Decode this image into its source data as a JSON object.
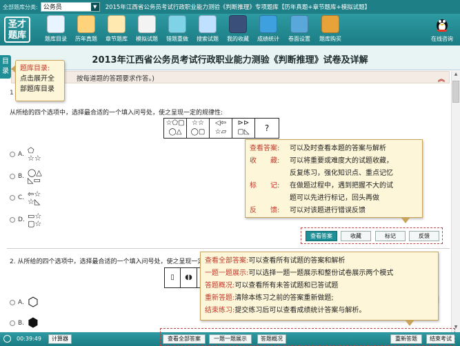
{
  "topbar": {
    "category_label": "全部题库分类:",
    "category_value": "公务员",
    "title": "2015年江西省公务员考试行政职业能力测验《判断推理》专项题库【历年真题+章节题库+模拟试题】"
  },
  "logo": {
    "line1": "圣才",
    "line2": "题库"
  },
  "toolbar": [
    {
      "label": "题库目录",
      "icon": "monitor-icon",
      "color": "#e8f4ff"
    },
    {
      "label": "历年真题",
      "icon": "book-icon",
      "color": "#ffd37a"
    },
    {
      "label": "章节题库",
      "icon": "pencil-note-icon",
      "color": "#ffe9b0"
    },
    {
      "label": "模拟试题",
      "icon": "paper-pen-icon",
      "color": "#f3f3f3"
    },
    {
      "label": "错题重做",
      "icon": "refresh-icon",
      "color": "#7fd3e6"
    },
    {
      "label": "搜索试题",
      "icon": "search-globe-icon",
      "color": "#bfe0ff"
    },
    {
      "label": "我的收藏",
      "icon": "bookmark-star-icon",
      "color": "#3a4f7a"
    },
    {
      "label": "成绩统计",
      "icon": "globe-icon",
      "color": "#3fa0e0"
    },
    {
      "label": "卷面设置",
      "icon": "gear-icon",
      "color": "#5aa7d9"
    },
    {
      "label": "题库购买",
      "icon": "cart-icon",
      "color": "#e8a23a"
    }
  ],
  "online": {
    "label": "在线咨询",
    "icon": "penguin-icon"
  },
  "exam_title": "2013年江西省公务员考试行政职业能力测验《判断推理》试卷及详解",
  "mulu_tab": "目录",
  "tip_mulu": {
    "title": "题库目录:",
    "body": "点击展开全部题库目录"
  },
  "instruction_text": "按每道题的答题要求作答。)",
  "q1": {
    "num": "1",
    "stem": "从所给的四个选项中，选择最合适的一个填入问号处，使之呈现一定的规律性:",
    "seq_cells": [
      "☆⬠▢\n◯△",
      "☆☆\n◯▢",
      "◁⇦\n☆▱",
      "⊳⊳\n▢◺",
      "?"
    ],
    "options": [
      {
        "letter": "A.",
        "symbols": "⬠\n☆☆"
      },
      {
        "letter": "B.",
        "symbols": "◯△\n◺▭"
      },
      {
        "letter": "C.",
        "symbols": "⇦☆\n☆◺"
      },
      {
        "letter": "D.",
        "symbols": "▭☆\n▢☆"
      }
    ],
    "actions": [
      "查看答案",
      "收藏",
      "标记",
      "反馈"
    ]
  },
  "tip_q": [
    {
      "k": "查看答案:",
      "v": "可以及时查看本题的答案与解析"
    },
    {
      "k": "收　　藏:",
      "v": "可以将重要或难度大的试题收藏，"
    },
    {
      "k": "",
      "v": "反复练习，强化知识点、重点记忆"
    },
    {
      "k": "标　　记:",
      "v": "在做题过程中，遇到把握不大的试"
    },
    {
      "k": "",
      "v": "题可以先进行标记，回头再做"
    },
    {
      "k": "反　　馈:",
      "v": "可以对该题进行错误反馈"
    }
  ],
  "q2": {
    "stem": "2. 从所给的四个选项中，选择最合适的一个填入问号处，使之呈现一定的规律性:",
    "fig_cells": [
      "▯",
      "◖◗",
      "◩"
    ],
    "options": [
      {
        "letter": "A.",
        "symbols": "⬡"
      },
      {
        "letter": "B.",
        "symbols": "⬢"
      }
    ]
  },
  "tip_bot": [
    {
      "k": "查看全部答案:",
      "v": "可以查看所有试题的答案和解析"
    },
    {
      "k": "一题一题展示:",
      "v": "可以选择一题一题展示和整份试卷展示两个模式"
    },
    {
      "k": "答题概况:",
      "v": "可以查看所有未答试题和已答试题"
    },
    {
      "k": "重新答题:",
      "v": "清除本练习之前的答案重新做题;"
    },
    {
      "k": "结束练习:",
      "v": "提交练习后可以查看成绩统计答案与解析。"
    }
  ],
  "status": {
    "time": "00:39:49",
    "calculator": "计算器",
    "buttons": [
      "查看全部答案",
      "一题一题展示",
      "答题概况",
      "重新答题",
      "结束考试"
    ]
  },
  "colors": {
    "teal": "#1f8f97",
    "accent_red": "#c0392b",
    "tip_bg": "#fdf6d8"
  }
}
